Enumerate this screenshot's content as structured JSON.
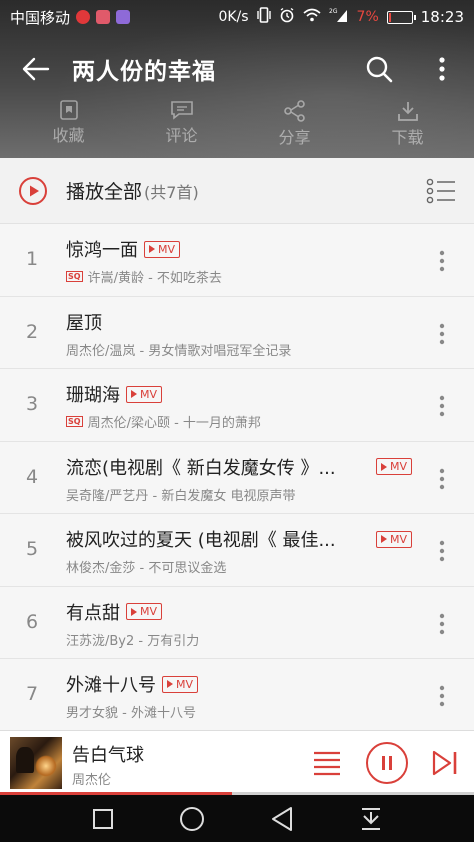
{
  "status_bar": {
    "carrier": "中国移动",
    "netspeed": "0K/s",
    "network": "2G",
    "battery_percent": "7%",
    "battery_level": 0.07,
    "time": "18:23"
  },
  "header": {
    "title": "两人份的幸福",
    "back_icon": "back-arrow-icon",
    "search_icon": "search-icon",
    "more_icon": "more-vertical-icon"
  },
  "actions": [
    {
      "label": "收藏",
      "icon": "favorite-icon"
    },
    {
      "label": "评论",
      "icon": "comment-icon"
    },
    {
      "label": "分享",
      "icon": "share-icon"
    },
    {
      "label": "下载",
      "icon": "download-icon"
    }
  ],
  "play_all": {
    "label": "播放全部",
    "count": "(共7首)"
  },
  "songs": [
    {
      "index": "1",
      "title": "惊鸿一面",
      "mv": "MV",
      "sq": "SQ",
      "subtitle": "许嵩/黄龄 - 不如吃茶去"
    },
    {
      "index": "2",
      "title": "屋顶",
      "mv": "",
      "sq": "",
      "subtitle": "周杰伦/温岚 - 男女情歌对唱冠军全记录"
    },
    {
      "index": "3",
      "title": "珊瑚海",
      "mv": "MV",
      "sq": "SQ",
      "subtitle": "周杰伦/梁心颐 - 十一月的萧邦"
    },
    {
      "index": "4",
      "title": "流恋(电视剧《 新白发魔女传 》...",
      "mv": "MV",
      "sq": "",
      "subtitle": "吴奇隆/严艺丹 - 新白发魔女 电视原声带"
    },
    {
      "index": "5",
      "title": "被风吹过的夏天 (电视剧《 最佳...",
      "mv": "MV",
      "sq": "",
      "subtitle": "林俊杰/金莎 - 不可思议金选"
    },
    {
      "index": "6",
      "title": "有点甜",
      "mv": "MV",
      "sq": "",
      "subtitle": "汪苏泷/By2 - 万有引力"
    },
    {
      "index": "7",
      "title": "外滩十八号",
      "mv": "MV",
      "sq": "",
      "subtitle": "男才女貌 - 外滩十八号"
    }
  ],
  "now_playing": {
    "title": "告白气球",
    "artist": "周杰伦",
    "progress": 0.49
  },
  "colors": {
    "accent": "#d9403a",
    "header_bg": "#3a3a3a",
    "list_bg": "#f6f6f6"
  }
}
